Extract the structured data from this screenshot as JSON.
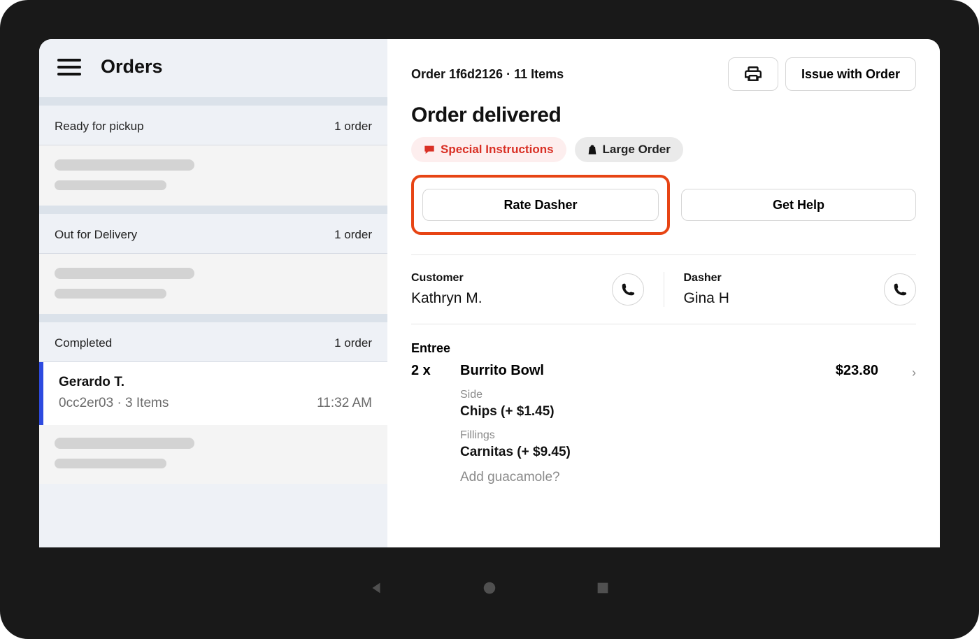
{
  "sidebar": {
    "title": "Orders",
    "sections": [
      {
        "label": "Ready for pickup",
        "count": "1 order"
      },
      {
        "label": "Out for Delivery",
        "count": "1 order"
      },
      {
        "label": "Completed",
        "count": "1 order"
      }
    ],
    "completed_order": {
      "name": "Gerardo T.",
      "meta": "0cc2er03 · 3 Items",
      "time": "11:32 AM"
    }
  },
  "main": {
    "order_meta": "Order 1f6d2126 · 11 Items",
    "issue_button": "Issue with Order",
    "status": "Order delivered",
    "tags": {
      "special": "Special Instructions",
      "large": "Large Order"
    },
    "actions": {
      "rate": "Rate Dasher",
      "help": "Get Help"
    },
    "customer": {
      "label": "Customer",
      "name": "Kathryn M."
    },
    "dasher": {
      "label": "Dasher",
      "name": "Gina H"
    },
    "items_heading": "Entree",
    "item": {
      "qty": "2 x",
      "name": "Burrito Bowl",
      "price": "$23.80",
      "mods": [
        {
          "label": "Side",
          "value": "Chips (+ $1.45)"
        },
        {
          "label": "Fillings",
          "value": "Carnitas (+ $9.45)"
        }
      ],
      "faded": "Add guacamole?"
    }
  }
}
